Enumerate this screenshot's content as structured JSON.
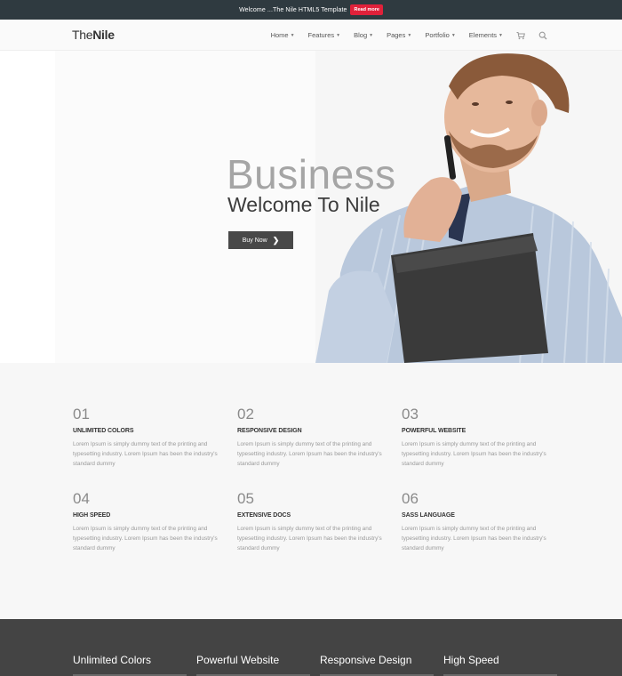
{
  "topbar": {
    "text": "Welcome ...The Nile HTML5 Template",
    "button_label": "Read more"
  },
  "header": {
    "logo_light": "The",
    "logo_bold": "Nile",
    "nav": [
      {
        "label": "Home"
      },
      {
        "label": "Features"
      },
      {
        "label": "Blog"
      },
      {
        "label": "Pages"
      },
      {
        "label": "Portfolio"
      },
      {
        "label": "Elements"
      }
    ],
    "icons": [
      "cart-icon",
      "search-icon"
    ]
  },
  "hero": {
    "title": "Business",
    "subtitle": "Welcome To Nile",
    "button_label": "Buy Now"
  },
  "features": [
    {
      "num": "01",
      "title": "UNLIMITED COLORS",
      "text": "Lorem Ipsum is simply dummy text of the printing and typesetting industry. Lorem Ipsum has been the industry's standard dummy"
    },
    {
      "num": "02",
      "title": "RESPONSIVE DESIGN",
      "text": "Lorem Ipsum is simply dummy text of the printing and typesetting industry. Lorem Ipsum has been the industry's standard dummy"
    },
    {
      "num": "03",
      "title": "POWERFUL WEBSITE",
      "text": "Lorem Ipsum is simply dummy text of the printing and typesetting industry. Lorem Ipsum has been the industry's standard dummy"
    },
    {
      "num": "04",
      "title": "HIGH SPEED",
      "text": "Lorem Ipsum is simply dummy text of the printing and typesetting industry. Lorem Ipsum has been the industry's standard dummy"
    },
    {
      "num": "05",
      "title": "EXTENSIVE DOCS",
      "text": "Lorem Ipsum is simply dummy text of the printing and typesetting industry. Lorem Ipsum has been the industry's standard dummy"
    },
    {
      "num": "06",
      "title": "SASS LANGUAGE",
      "text": "Lorem Ipsum is simply dummy text of the printing and typesetting industry. Lorem Ipsum has been the industry's standard dummy"
    }
  ],
  "darkband": {
    "cols": [
      "Unlimited Colors",
      "Powerful Website",
      "Responsive Design",
      "High Speed"
    ]
  },
  "colors": {
    "topbar_bg": "#2f3a40",
    "accent_red": "#e0213a",
    "button_dark": "#484848",
    "footer_bg": "#444444"
  }
}
